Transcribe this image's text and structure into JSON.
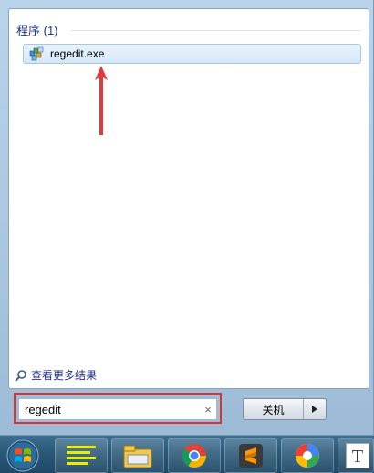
{
  "start_menu": {
    "section_header": "程序 (1)",
    "results": [
      {
        "label": "regedit.exe",
        "icon": "registry-editor-icon"
      }
    ],
    "see_more_label": "查看更多结果",
    "search": {
      "value": "regedit",
      "clear_symbol": "×"
    },
    "shutdown": {
      "label": "关机",
      "arrow_symbol": "▸"
    },
    "annotation_color": "#e03030"
  },
  "taskbar": {
    "items": [
      {
        "icon": "start-orb-icon"
      },
      {
        "icon": "notes-app-icon"
      },
      {
        "icon": "file-explorer-icon"
      },
      {
        "icon": "chrome-icon"
      },
      {
        "icon": "sublime-text-icon"
      },
      {
        "icon": "pinwheel-app-icon"
      },
      {
        "icon": "text-app-icon",
        "glyph": "T"
      }
    ]
  }
}
